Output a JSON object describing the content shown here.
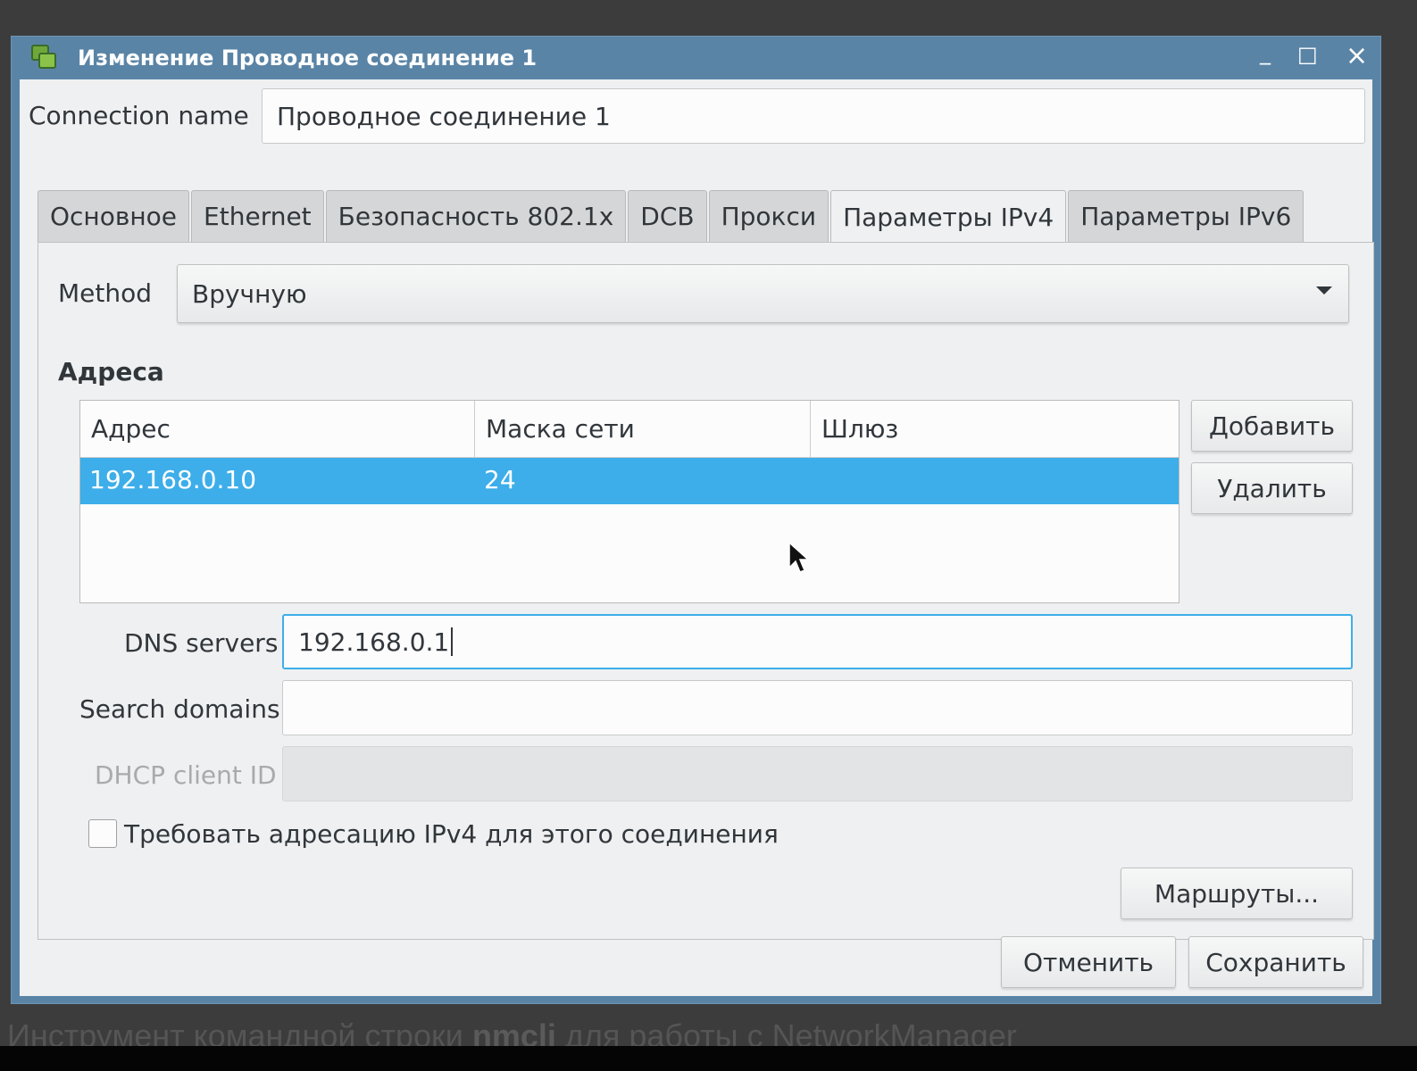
{
  "background": {
    "text_pre": "Инструмент командной строки ",
    "text_bold": "nmcli",
    "text_post": " для работы с NetworkManager"
  },
  "window": {
    "title": "Изменение Проводное соединение 1",
    "minimize": "_",
    "maximize": "□",
    "close": "×"
  },
  "connection_name": {
    "label": "Connection name",
    "value": "Проводное соединение 1"
  },
  "tabs": [
    {
      "label": "Основное"
    },
    {
      "label": "Ethernet"
    },
    {
      "label": "Безопасность 802.1x"
    },
    {
      "label": "DCB"
    },
    {
      "label": "Прокси"
    },
    {
      "label": "Параметры IPv4",
      "active": true
    },
    {
      "label": "Параметры IPv6"
    }
  ],
  "ipv4": {
    "method_label": "Method",
    "method_value": "Вручную",
    "addresses_heading": "Адреса",
    "columns": [
      "Адрес",
      "Маска сети",
      "Шлюз"
    ],
    "rows": [
      {
        "address": "192.168.0.10",
        "netmask": "24",
        "gateway": ""
      }
    ],
    "add_button": "Добавить",
    "delete_button": "Удалить",
    "dns_label": "DNS servers",
    "dns_value": "192.168.0.1",
    "search_label": "Search domains",
    "search_value": "",
    "dhcp_label": "DHCP client ID",
    "dhcp_value": "",
    "require_label": "Требовать адресацию IPv4 для этого соединения",
    "require_checked": false,
    "routes_button": "Маршруты..."
  },
  "footer": {
    "cancel": "Отменить",
    "save": "Сохранить"
  },
  "colors": {
    "titlebar": "#5a84a6",
    "selection": "#3daee9",
    "focus": "#3daee9"
  }
}
